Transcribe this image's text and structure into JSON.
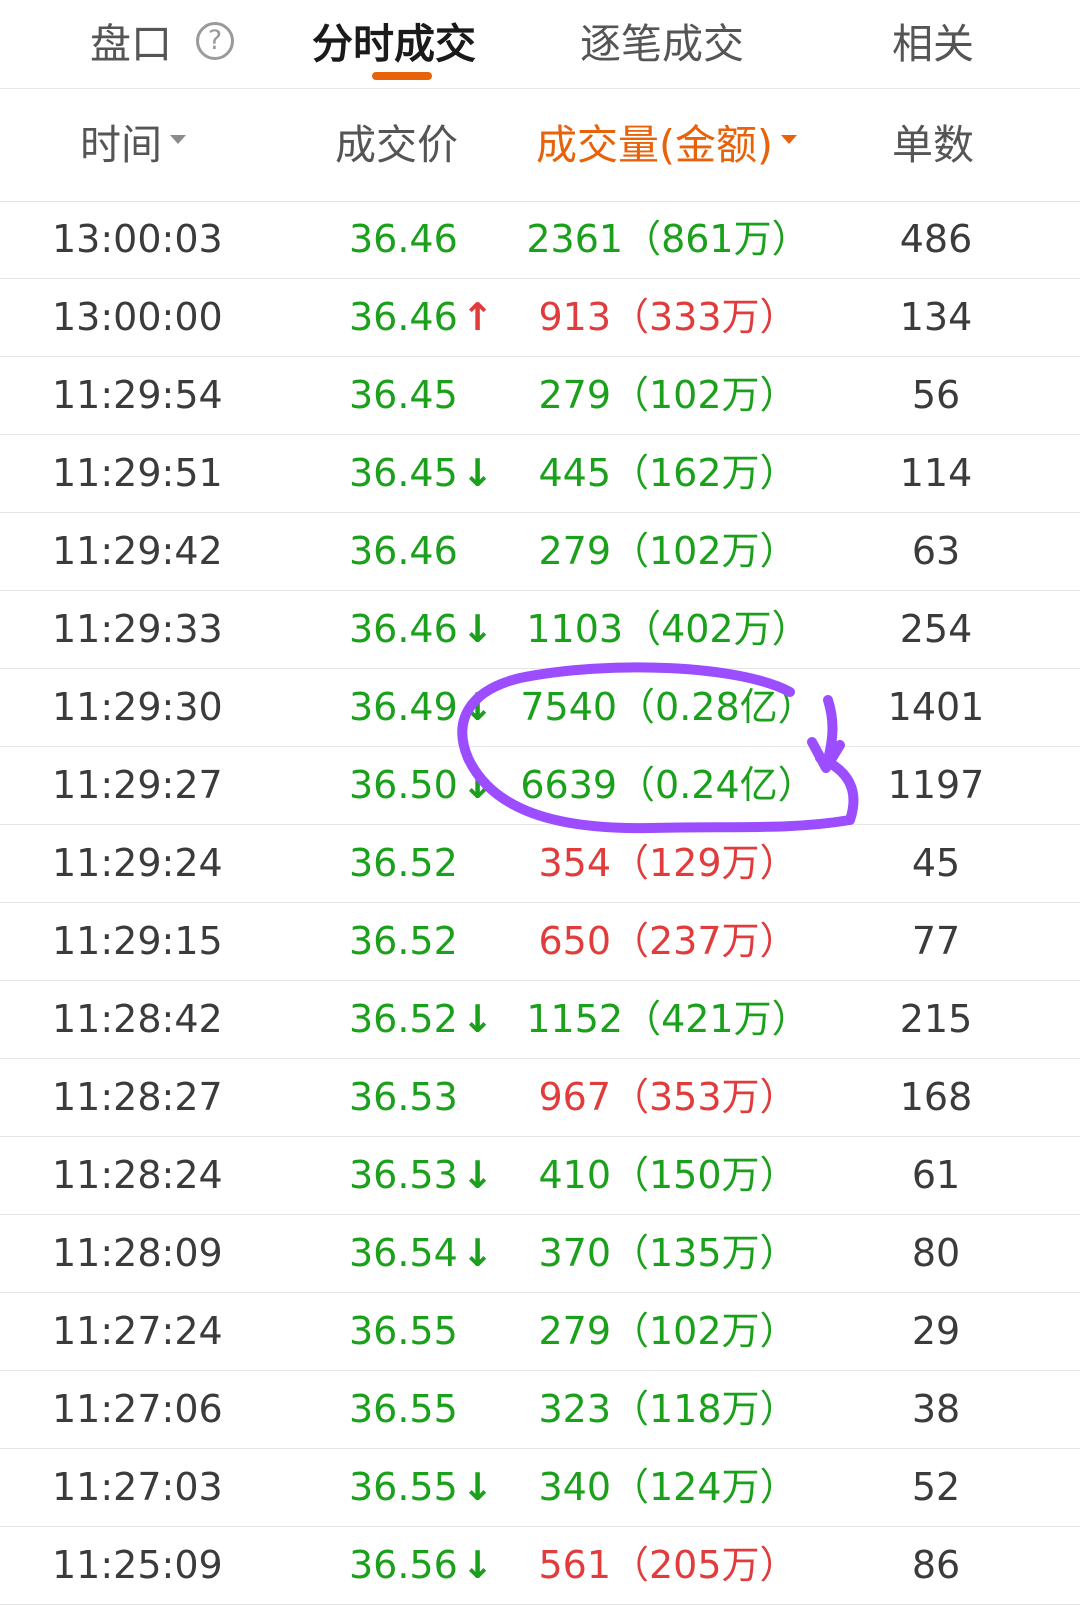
{
  "tabs": [
    {
      "label": "盘口",
      "active": false
    },
    {
      "label": "分时成交",
      "active": true
    },
    {
      "label": "逐笔成交",
      "active": false
    },
    {
      "label": "相关",
      "active": false
    }
  ],
  "help_icon_glyph": "?",
  "columns": {
    "time": "时间",
    "price": "成交价",
    "volume": "成交量(金额)",
    "count": "单数"
  },
  "colors": {
    "up": "#e03c3c",
    "down": "#1aa01a",
    "accent": "#e8620a",
    "annotation": "#9b4dff"
  },
  "rows": [
    {
      "time": "13:00:03",
      "price": "36.46",
      "arrow": "",
      "volume": "2361（861万）",
      "vol_color": "green",
      "count": "486"
    },
    {
      "time": "13:00:00",
      "price": "36.46",
      "arrow": "up",
      "volume": "913（333万）",
      "vol_color": "red",
      "count": "134"
    },
    {
      "time": "11:29:54",
      "price": "36.45",
      "arrow": "",
      "volume": "279（102万）",
      "vol_color": "green",
      "count": "56"
    },
    {
      "time": "11:29:51",
      "price": "36.45",
      "arrow": "down",
      "volume": "445（162万）",
      "vol_color": "green",
      "count": "114"
    },
    {
      "time": "11:29:42",
      "price": "36.46",
      "arrow": "",
      "volume": "279（102万）",
      "vol_color": "green",
      "count": "63"
    },
    {
      "time": "11:29:33",
      "price": "36.46",
      "arrow": "down",
      "volume": "1103（402万）",
      "vol_color": "green",
      "count": "254"
    },
    {
      "time": "11:29:30",
      "price": "36.49",
      "arrow": "down",
      "volume": "7540（0.28亿）",
      "vol_color": "green",
      "count": "1401"
    },
    {
      "time": "11:29:27",
      "price": "36.50",
      "arrow": "down",
      "volume": "6639（0.24亿）",
      "vol_color": "green",
      "count": "1197"
    },
    {
      "time": "11:29:24",
      "price": "36.52",
      "arrow": "",
      "volume": "354（129万）",
      "vol_color": "red",
      "count": "45"
    },
    {
      "time": "11:29:15",
      "price": "36.52",
      "arrow": "",
      "volume": "650（237万）",
      "vol_color": "red",
      "count": "77"
    },
    {
      "time": "11:28:42",
      "price": "36.52",
      "arrow": "down",
      "volume": "1152（421万）",
      "vol_color": "green",
      "count": "215"
    },
    {
      "time": "11:28:27",
      "price": "36.53",
      "arrow": "",
      "volume": "967（353万）",
      "vol_color": "red",
      "count": "168"
    },
    {
      "time": "11:28:24",
      "price": "36.53",
      "arrow": "down",
      "volume": "410（150万）",
      "vol_color": "green",
      "count": "61"
    },
    {
      "time": "11:28:09",
      "price": "36.54",
      "arrow": "down",
      "volume": "370（135万）",
      "vol_color": "green",
      "count": "80"
    },
    {
      "time": "11:27:24",
      "price": "36.55",
      "arrow": "",
      "volume": "279（102万）",
      "vol_color": "green",
      "count": "29"
    },
    {
      "time": "11:27:06",
      "price": "36.55",
      "arrow": "",
      "volume": "323（118万）",
      "vol_color": "green",
      "count": "38"
    },
    {
      "time": "11:27:03",
      "price": "36.55",
      "arrow": "down",
      "volume": "340（124万）",
      "vol_color": "green",
      "count": "52"
    },
    {
      "time": "11:25:09",
      "price": "36.56",
      "arrow": "down",
      "volume": "561（205万）",
      "vol_color": "red",
      "count": "86"
    }
  ]
}
